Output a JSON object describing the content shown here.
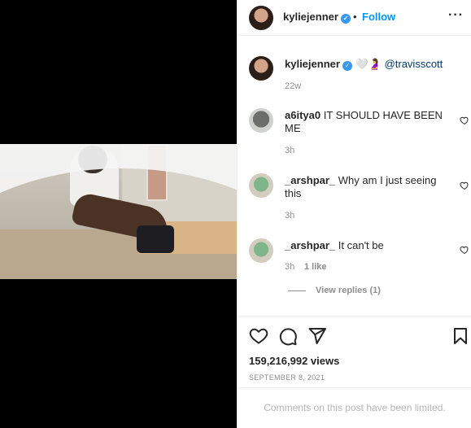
{
  "post": {
    "author": "kyliejenner",
    "separator": "•",
    "follow_label": "Follow",
    "more_label": "···"
  },
  "caption": {
    "username": "kyliejenner",
    "emoji": "🤍🤰",
    "mention": "@travisscott",
    "time": "22w"
  },
  "comments": [
    {
      "username": "a6itya0",
      "text": "IT SHOULD HAVE BEEN ME",
      "time": "3h",
      "likes": ""
    },
    {
      "username": "_arshpar_",
      "text": "Why am I just seeing this",
      "time": "3h",
      "likes": ""
    },
    {
      "username": "_arshpar_",
      "text": "It can't be",
      "time": "3h",
      "likes": "1 like"
    }
  ],
  "view_replies_label": "View replies (1)",
  "stats": {
    "views": "159,216,992 views",
    "date": "SEPTEMBER 8, 2021"
  },
  "footer": {
    "limited_text": "Comments on this post have been limited."
  },
  "icons": {
    "like": "heart-icon",
    "comment": "comment-icon",
    "share": "share-icon",
    "save": "bookmark-icon",
    "verified": "verified-badge-icon",
    "more": "more-options-icon"
  },
  "colors": {
    "follow": "#0095f6",
    "verified": "#3897f0",
    "muted": "#8e8e8e"
  }
}
